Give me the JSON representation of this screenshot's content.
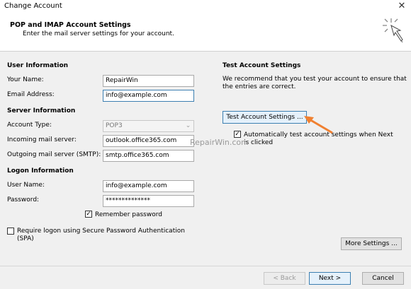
{
  "window": {
    "title": "Change Account",
    "close_glyph": "✕"
  },
  "header": {
    "title": "POP and IMAP Account Settings",
    "subtitle": "Enter the mail server settings for your account.",
    "icon": "wizard-sparkle-icon"
  },
  "user_info": {
    "heading": "User Information",
    "your_name_label": "Your Name:",
    "your_name_value": "RepairWin",
    "email_label": "Email Address:",
    "email_value": "info@example.com"
  },
  "server_info": {
    "heading": "Server Information",
    "account_type_label": "Account Type:",
    "account_type_value": "POP3",
    "incoming_label": "Incoming mail server:",
    "incoming_value": "outlook.office365.com",
    "outgoing_label": "Outgoing mail server (SMTP):",
    "outgoing_value": "smtp.office365.com"
  },
  "logon_info": {
    "heading": "Logon Information",
    "user_name_label": "User Name:",
    "user_name_value": "info@example.com",
    "password_label": "Password:",
    "password_value": "**************",
    "remember_label": "Remember password",
    "remember_checked": true,
    "spa_label_line1": "Require logon using Secure Password Authentication",
    "spa_label_line2": "(SPA)",
    "spa_checked": false
  },
  "test_settings": {
    "heading": "Test Account Settings",
    "description_line1": "We recommend that you test your account to ensure that",
    "description_line2": "the entries are correct.",
    "test_button": "Test Account Settings ...",
    "auto_test_line1": "Automatically test account settings when Next",
    "auto_test_line2": "is clicked",
    "auto_test_checked": true
  },
  "watermark": "RepairWin.com",
  "more_settings_button": "More Settings ...",
  "footer": {
    "back_button": "< Back",
    "next_button": "Next >",
    "cancel_button": "Cancel"
  },
  "colors": {
    "arrow": "#f08030",
    "accent": "#3c7fb1"
  }
}
